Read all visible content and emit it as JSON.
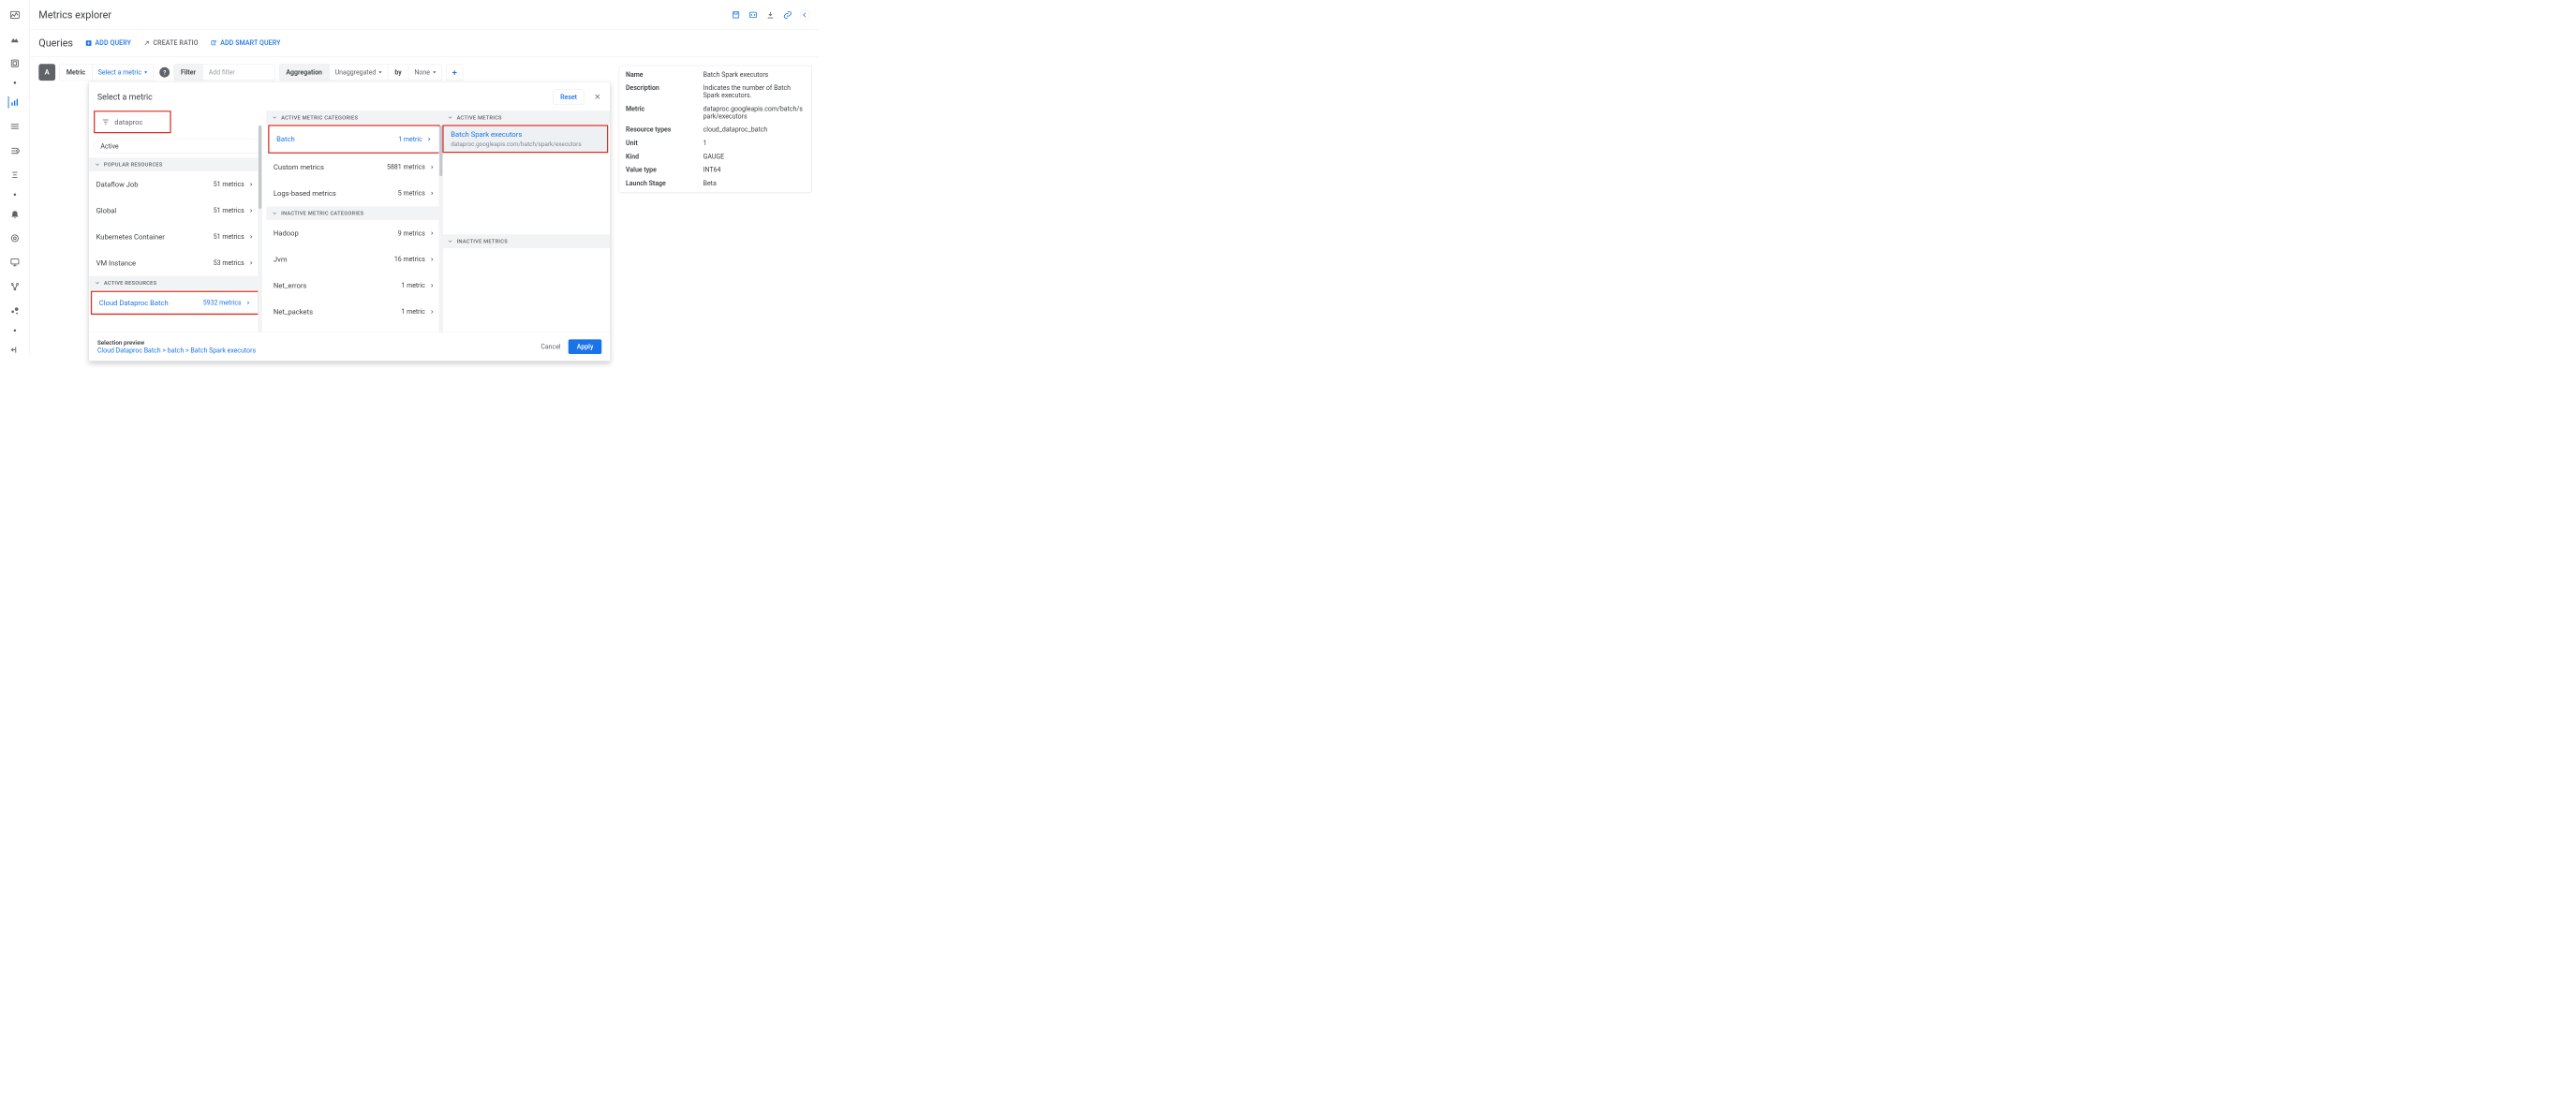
{
  "page": {
    "title": "Metrics explorer",
    "section_title": "Queries"
  },
  "toolbar": {
    "add_query": "ADD QUERY",
    "create_ratio": "CREATE RATIO",
    "add_smart_query": "ADD SMART QUERY"
  },
  "builder": {
    "query_letter": "A",
    "metric_label": "Metric",
    "metric_value": "Select a metric",
    "filter_label": "Filter",
    "filter_placeholder": "Add filter",
    "aggregation_label": "Aggregation",
    "aggregation_value": "Unaggregated",
    "by_label": "by",
    "by_value": "None"
  },
  "picker": {
    "title": "Select a metric",
    "reset": "Reset",
    "search_value": "dataproc",
    "active_pill": "Active",
    "col1": {
      "popular_head": "POPULAR RESOURCES",
      "active_res_head": "ACTIVE RESOURCES",
      "popular": [
        {
          "name": "Dataflow Job",
          "count": "51 metrics"
        },
        {
          "name": "Global",
          "count": "51 metrics"
        },
        {
          "name": "Kubernetes Container",
          "count": "51 metrics"
        },
        {
          "name": "VM Instance",
          "count": "53 metrics"
        }
      ],
      "active_selected": {
        "name": "Cloud Dataproc Batch",
        "count": "5932 metrics"
      }
    },
    "col2": {
      "active_head": "ACTIVE METRIC CATEGORIES",
      "inactive_head": "INACTIVE METRIC CATEGORIES",
      "active_selected": {
        "name": "Batch",
        "count": "1 metric"
      },
      "active_rest": [
        {
          "name": "Custom metrics",
          "count": "5881 metrics"
        },
        {
          "name": "Logs-based metrics",
          "count": "5 metrics"
        }
      ],
      "inactive": [
        {
          "name": "Hadoop",
          "count": "9 metrics"
        },
        {
          "name": "Jvm",
          "count": "16 metrics"
        },
        {
          "name": "Net_errors",
          "count": "1 metric"
        },
        {
          "name": "Net_packets",
          "count": "1 metric"
        }
      ]
    },
    "col3": {
      "active_head": "ACTIVE METRICS",
      "inactive_head": "INACTIVE METRICS",
      "selected": {
        "name": "Batch Spark executors",
        "path": "dataproc.googleapis.com/batch/spark/executors"
      }
    },
    "footer": {
      "preview_label": "Selection preview",
      "preview_path": "Cloud Dataproc Batch > batch > Batch Spark executors",
      "cancel": "Cancel",
      "apply": "Apply"
    }
  },
  "detail": {
    "rows": [
      {
        "k": "Name",
        "v": "Batch Spark executors"
      },
      {
        "k": "Description",
        "v": "Indicates the number of Batch Spark executors."
      },
      {
        "k": "Metric",
        "v": "dataproc.googleapis.com/batch/spark/executors"
      },
      {
        "k": "Resource types",
        "v": "cloud_dataproc_batch"
      },
      {
        "k": "Unit",
        "v": "1"
      },
      {
        "k": "Kind",
        "v": "GAUGE"
      },
      {
        "k": "Value type",
        "v": "INT64"
      },
      {
        "k": "Launch Stage",
        "v": "Beta"
      }
    ]
  }
}
